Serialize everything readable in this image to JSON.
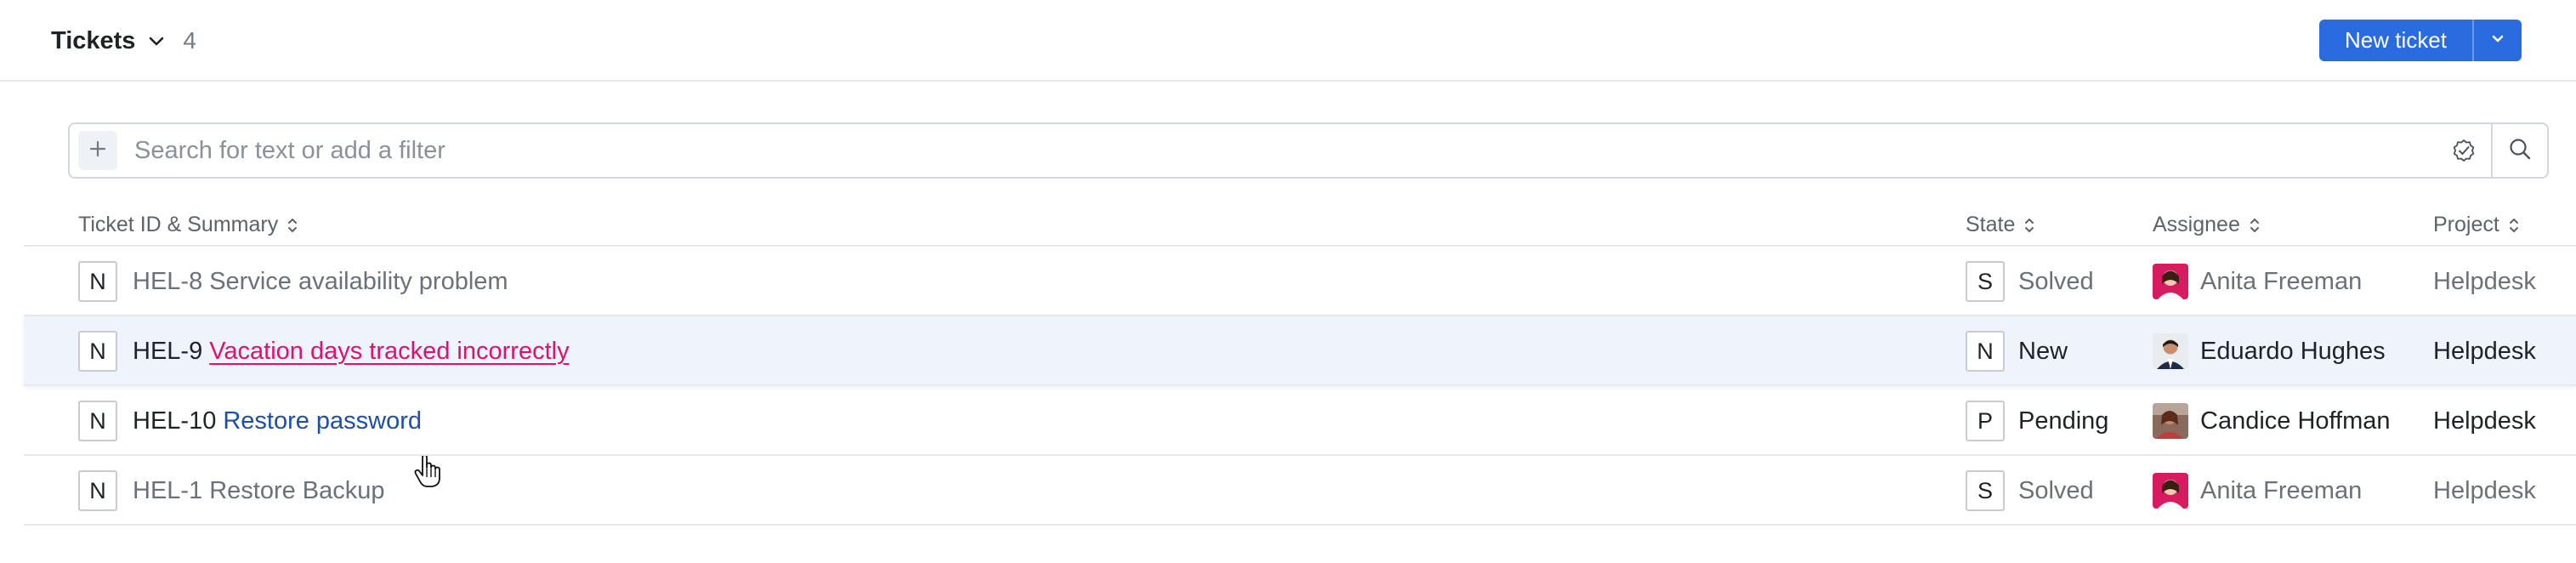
{
  "header": {
    "title": "Tickets",
    "count": "4",
    "new_ticket_label": "New ticket"
  },
  "search": {
    "placeholder": "Search for text or add a filter",
    "add_glyph": "+"
  },
  "columns": {
    "summary": "Ticket ID & Summary",
    "state": "State",
    "assignee": "Assignee",
    "project": "Project"
  },
  "rows": [
    {
      "type": "N",
      "id": "HEL-8",
      "summary": "Service availability problem",
      "state_code": "S",
      "state": "Solved",
      "assignee": "Anita Freeman",
      "project": "Helpdesk"
    },
    {
      "type": "N",
      "id": "HEL-9",
      "summary": "Vacation days tracked incorrectly",
      "state_code": "N",
      "state": "New",
      "assignee": "Eduardo Hughes",
      "project": "Helpdesk"
    },
    {
      "type": "N",
      "id": "HEL-10",
      "summary": "Restore password",
      "state_code": "P",
      "state": "Pending",
      "assignee": "Candice Hoffman",
      "project": "Helpdesk"
    },
    {
      "type": "N",
      "id": "HEL-1",
      "summary": "Restore Backup",
      "state_code": "S",
      "state": "Solved",
      "assignee": "Anita Freeman",
      "project": "Helpdesk"
    }
  ],
  "colors": {
    "primary": "#2a6be0",
    "link_hover": "#e0116e",
    "link": "#1b4fa8",
    "row_hover_bg": "#eef3fc"
  },
  "icons": [
    "chevron-down-icon",
    "plus-icon",
    "check-badge-icon",
    "search-icon",
    "sort-icon",
    "hand-cursor-icon"
  ]
}
